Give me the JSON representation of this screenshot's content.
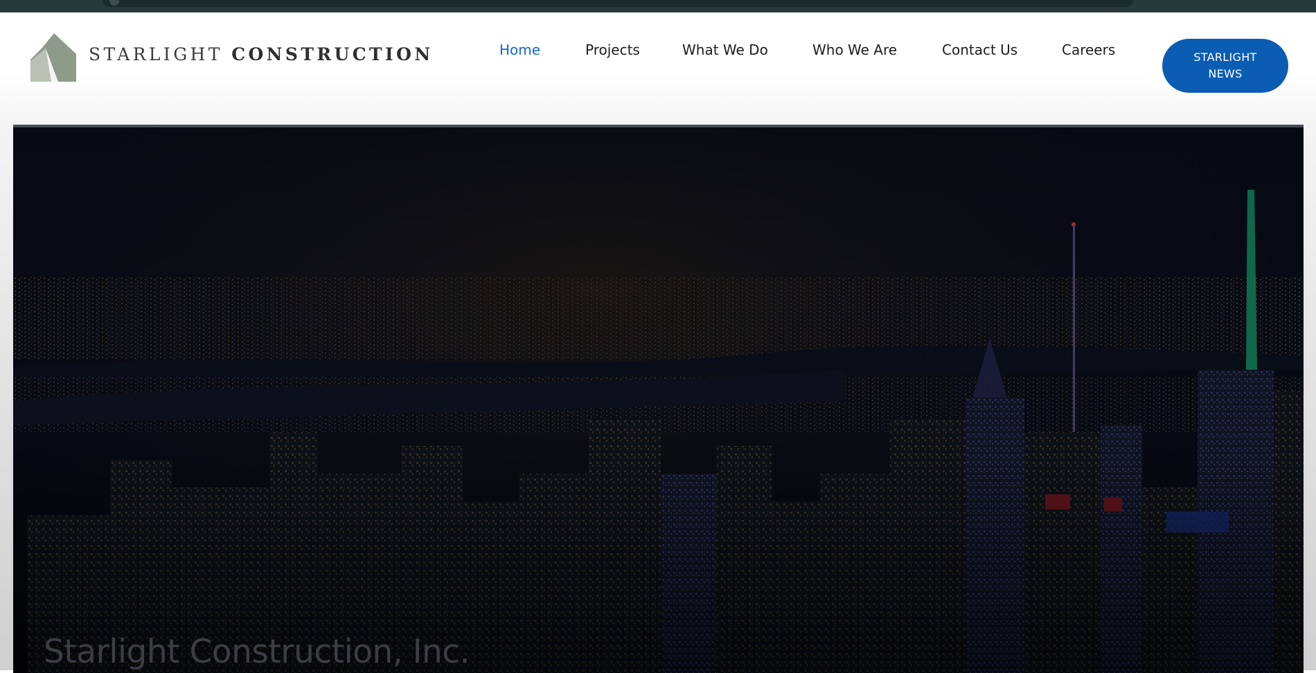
{
  "brand": {
    "name_light": "STARLIGHT ",
    "name_bold": "CONSTRUCTION",
    "logo_color": "#8e9a8a"
  },
  "nav": {
    "items": [
      {
        "label": "Home",
        "active": true
      },
      {
        "label": "Projects",
        "active": false
      },
      {
        "label": "What We Do",
        "active": false
      },
      {
        "label": "Who We Are",
        "active": false
      },
      {
        "label": "Contact Us",
        "active": false
      },
      {
        "label": "Careers",
        "active": false
      }
    ],
    "active_color": "#1665d8"
  },
  "news_button": {
    "line1": "STARLIGHT",
    "line2": "NEWS",
    "color": "#0b5db4"
  },
  "hero": {
    "title": "Starlight Construction, Inc.",
    "image_description_icon": "city-night-skyline"
  }
}
